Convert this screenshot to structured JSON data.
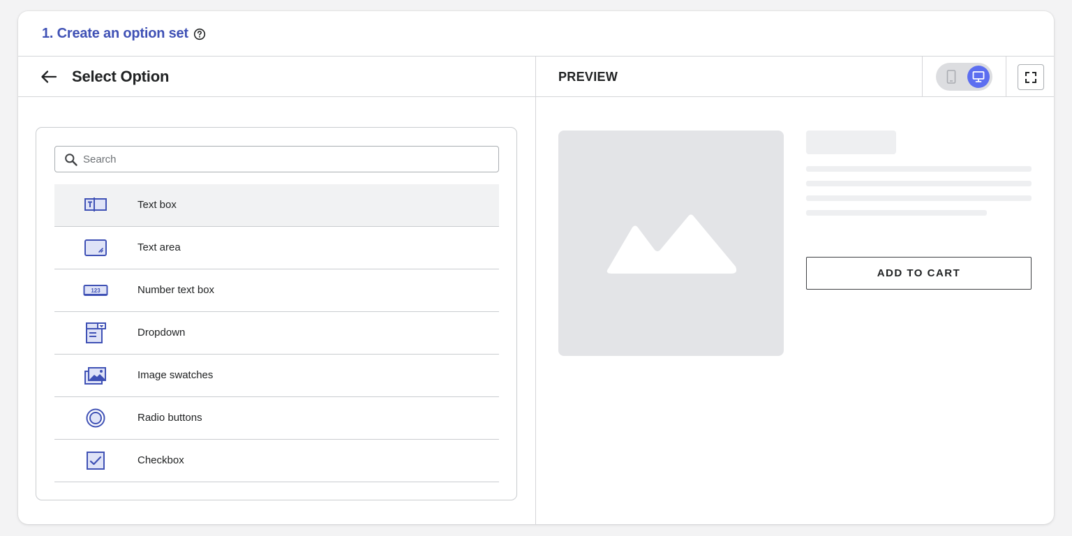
{
  "header": {
    "title": "1. Create an option set",
    "help_icon": "help-circle-icon"
  },
  "left_panel": {
    "back_icon": "arrow-left-icon",
    "title": "Select Option",
    "search": {
      "placeholder": "Search",
      "value": "",
      "icon": "search-icon"
    },
    "options": [
      {
        "label": "Text box",
        "icon": "text-box-icon",
        "selected": true
      },
      {
        "label": "Text area",
        "icon": "text-area-icon",
        "selected": false
      },
      {
        "label": "Number text box",
        "icon": "number-text-box-icon",
        "selected": false
      },
      {
        "label": "Dropdown",
        "icon": "dropdown-icon",
        "selected": false
      },
      {
        "label": "Image swatches",
        "icon": "image-swatches-icon",
        "selected": false
      },
      {
        "label": "Radio buttons",
        "icon": "radio-buttons-icon",
        "selected": false
      },
      {
        "label": "Checkbox",
        "icon": "checkbox-icon",
        "selected": false
      }
    ],
    "number_icon_text": "123"
  },
  "right_panel": {
    "title": "PREVIEW",
    "device_toggle": {
      "mobile_icon": "mobile-icon",
      "desktop_icon": "desktop-icon",
      "active": "desktop"
    },
    "fullscreen_icon": "fullscreen-icon",
    "image_placeholder_icon": "mountain-image-icon",
    "add_to_cart_label": "ADD TO CART"
  },
  "colors": {
    "accent": "#3f51b5",
    "icon": "#3f51b5",
    "icon_fill": "#dfe3f7",
    "toggle_active": "#5c6ef0"
  }
}
